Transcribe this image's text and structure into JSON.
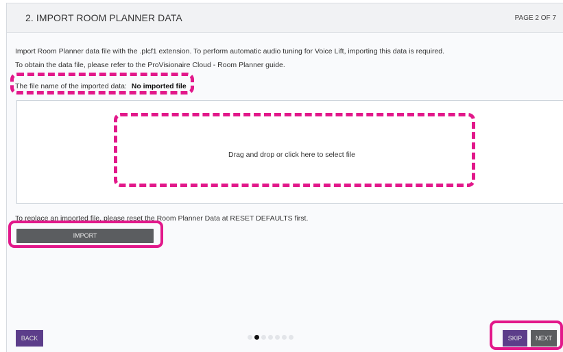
{
  "header": {
    "title": "2. IMPORT ROOM PLANNER DATA",
    "page_indicator": "PAGE 2 OF 7"
  },
  "main": {
    "description_1": "Import Room Planner data file with the .plcf1 extension. To perform automatic audio tuning for Voice Lift, importing this data is required.",
    "description_2": "To obtain the data file, please refer to the ProVisionaire Cloud - Room Planner guide.",
    "file_name_label": "The file name of the imported data:",
    "file_name_value": "No imported file",
    "drop_zone_text": "Drag and drop or click here to select file",
    "replace_note": "To replace an imported file, please reset the Room Planner Data at RESET DEFAULTS first.",
    "import_label": "IMPORT"
  },
  "footer": {
    "back_label": "BACK",
    "skip_label": "SKIP",
    "next_label": "NEXT",
    "pagination": {
      "total": 7,
      "current": 2
    }
  },
  "colors": {
    "accent_purple": "#5c3d8a",
    "button_gray": "#5b5d60",
    "highlight_magenta": "#e2188a"
  }
}
